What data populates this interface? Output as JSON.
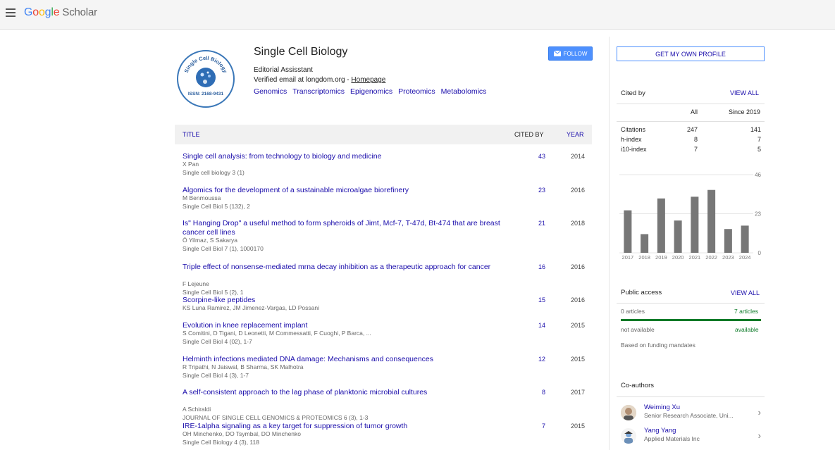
{
  "app": {
    "logo_google": "Google",
    "logo_scholar": "Scholar"
  },
  "profile": {
    "name": "Single Cell Biology",
    "avatar_text_top": "Single Cell Biology",
    "avatar_text_bottom": "ISSN: 2168-9431",
    "affiliation": "Editorial Assisstant",
    "verified_prefix": "Verified email at longdom.org - ",
    "homepage_label": "Homepage",
    "interests": [
      "Genomics",
      "Transcriptomics",
      "Epigenomics",
      "Proteomics",
      "Metabolomics"
    ],
    "follow_label": "FOLLOW"
  },
  "table": {
    "col_title": "TITLE",
    "col_cited": "CITED BY",
    "col_year": "YEAR",
    "rows": [
      {
        "title": "Single cell analysis: from technology to biology and medicine",
        "authors": "X Pan",
        "venue": "Single cell biology 3 (1)",
        "cites": "43",
        "year": "2014"
      },
      {
        "title": "Algomics for the development of a sustainable microalgae biorefinery",
        "authors": "M Benmoussa",
        "venue": "Single Cell Biol 5 (132), 2",
        "cites": "23",
        "year": "2016"
      },
      {
        "title": "Is\" Hanging Drop\" a useful method to form spheroids of Jimt, Mcf-7, T-47d, Bt-474 that are breast cancer cell lines",
        "authors": "Ö Yilmaz, S Sakarya",
        "venue": "Single Cell Biol 7 (1), 1000170",
        "cites": "21",
        "year": "2018"
      },
      {
        "title": "Triple effect of nonsense-mediated mrna decay inhibition as a therapeutic approach for cancer",
        "authors": "F Lejeune",
        "venue": "Single Cell Biol 5 (2), 1",
        "cites": "16",
        "year": "2016"
      },
      {
        "title": "Scorpine-like peptides",
        "authors": "KS Luna Ramirez, JM Jimenez-Vargas, LD Possani",
        "venue": "",
        "cites": "15",
        "year": "2016"
      },
      {
        "title": "Evolution in knee replacement implant",
        "authors": "S Comitini, D Tigani, D Leonetti, M Commessatti, F Cuoghi, P Barca, ...",
        "venue": "Single Cell Biol 4 (02), 1-7",
        "cites": "14",
        "year": "2015"
      },
      {
        "title": "Helminth infections mediated DNA damage: Mechanisms and consequences",
        "authors": "R Tripathi, N Jaiswal, B Sharma, SK Malhotra",
        "venue": "Single Cell Biol 4 (3), 1-7",
        "cites": "12",
        "year": "2015"
      },
      {
        "title": "A self-consistent approach to the lag phase of planktonic microbial cultures",
        "authors": "A Schiraldi",
        "venue": "JOURNAL OF SINGLE CELL GENOMICS & PROTEOMICS 6 (3), 1-3",
        "cites": "8",
        "year": "2017"
      },
      {
        "title": "IRE-1alpha signaling as a key target for suppression of tumor growth",
        "authors": "OH Minchenko, DO Tsymbal, DO Minchenko",
        "venue": "Single Cell Biology 4 (3), 118",
        "cites": "7",
        "year": "2015"
      }
    ]
  },
  "sidebar": {
    "get_profile_label": "GET MY OWN PROFILE",
    "cited_by": {
      "heading": "Cited by",
      "view_all": "VIEW ALL",
      "col_all": "All",
      "col_since": "Since 2019",
      "rows": [
        {
          "label": "Citations",
          "all": "247",
          "since": "141"
        },
        {
          "label": "h-index",
          "all": "8",
          "since": "7"
        },
        {
          "label": "i10-index",
          "all": "7",
          "since": "5"
        }
      ]
    },
    "public_access": {
      "heading": "Public access",
      "view_all": "VIEW ALL",
      "left_count": "0 articles",
      "right_count": "7 articles",
      "left_label": "not available",
      "right_label": "available",
      "note": "Based on funding mandates",
      "available_fraction": 1.0
    },
    "coauthors": {
      "heading": "Co-authors",
      "items": [
        {
          "name": "Weiming Xu",
          "affiliation": "Senior Research Associate, Uni..."
        },
        {
          "name": "Yang Yang",
          "affiliation": "Applied Materials Inc"
        }
      ]
    }
  },
  "chart_data": {
    "type": "bar",
    "categories": [
      "2017",
      "2018",
      "2019",
      "2020",
      "2021",
      "2022",
      "2023",
      "2024"
    ],
    "values": [
      25,
      11,
      32,
      19,
      33,
      37,
      14,
      16
    ],
    "y_ticks": [
      "46",
      "23",
      "0"
    ],
    "ylim": [
      0,
      46
    ],
    "bar_color": "#777777",
    "grid": true
  }
}
